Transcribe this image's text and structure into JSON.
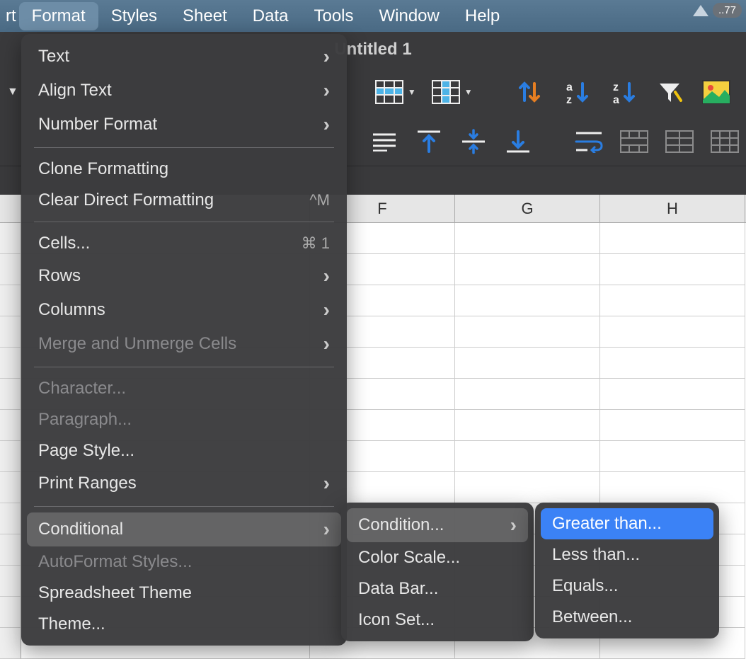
{
  "menubar": {
    "items": [
      "rt",
      "Format",
      "Styles",
      "Sheet",
      "Data",
      "Tools",
      "Window",
      "Help"
    ],
    "active_index": 1,
    "badge": "..77"
  },
  "title": "Untitled 1",
  "columns": [
    "F",
    "G",
    "H"
  ],
  "format_menu": {
    "items": [
      {
        "label": "Text",
        "submenu": true
      },
      {
        "label": "Align Text",
        "submenu": true
      },
      {
        "label": "Number Format",
        "submenu": true
      },
      {
        "sep": true
      },
      {
        "label": "Clone Formatting"
      },
      {
        "label": "Clear Direct Formatting",
        "shortcut": "^M"
      },
      {
        "sep": true
      },
      {
        "label": "Cells...",
        "shortcut": "⌘ 1"
      },
      {
        "label": "Rows",
        "submenu": true
      },
      {
        "label": "Columns",
        "submenu": true
      },
      {
        "label": "Merge and Unmerge Cells",
        "submenu": true,
        "disabled": true
      },
      {
        "sep": true
      },
      {
        "label": "Character...",
        "disabled": true
      },
      {
        "label": "Paragraph...",
        "disabled": true
      },
      {
        "label": "Page Style..."
      },
      {
        "label": "Print Ranges",
        "submenu": true
      },
      {
        "sep": true
      },
      {
        "label": "Conditional",
        "submenu": true,
        "highlight": true
      },
      {
        "label": "AutoFormat Styles...",
        "disabled": true
      },
      {
        "label": "Spreadsheet Theme"
      },
      {
        "label": "Theme..."
      }
    ]
  },
  "conditional_menu": {
    "items": [
      {
        "label": "Condition...",
        "submenu": true,
        "highlight": true
      },
      {
        "label": "Color Scale..."
      },
      {
        "label": "Data Bar..."
      },
      {
        "label": "Icon Set..."
      }
    ]
  },
  "condition_menu": {
    "items": [
      {
        "label": "Greater than...",
        "highlight_blue": true
      },
      {
        "label": "Less than..."
      },
      {
        "label": "Equals..."
      },
      {
        "label": "Between..."
      }
    ]
  }
}
